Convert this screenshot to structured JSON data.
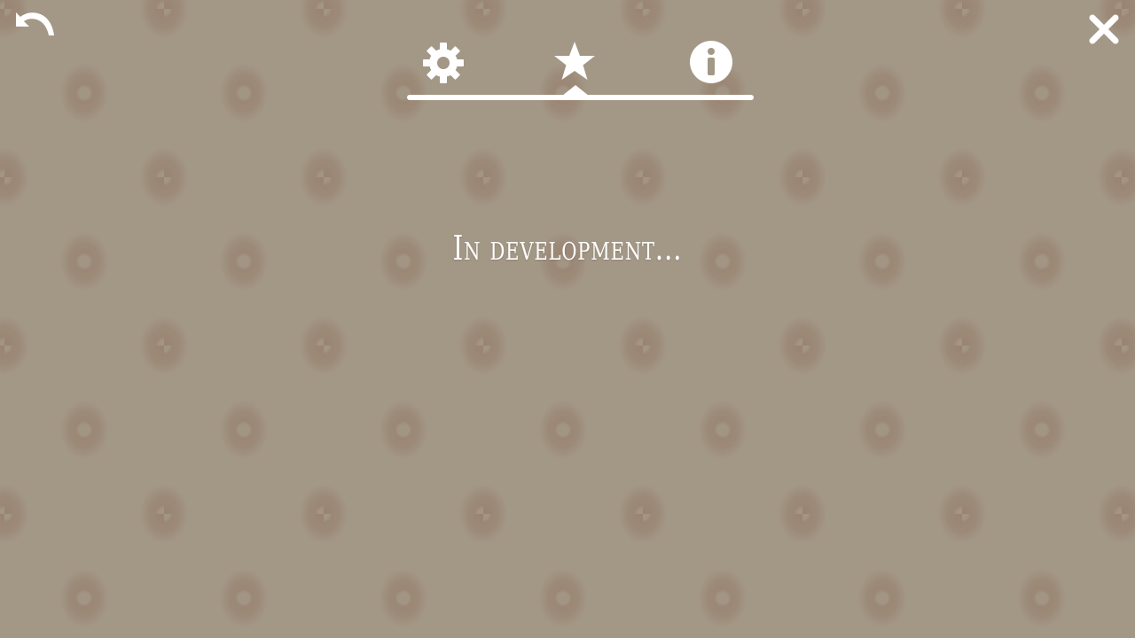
{
  "toolbar": {
    "back_icon": "undo-arrow-icon",
    "close_icon": "close-x-icon"
  },
  "tabs": [
    {
      "id": "settings",
      "icon": "gear-icon",
      "active": false
    },
    {
      "id": "favorites",
      "icon": "star-icon",
      "active": true
    },
    {
      "id": "info",
      "icon": "info-icon",
      "active": false
    }
  ],
  "content": {
    "message": "In development..."
  },
  "colors": {
    "background": "#a39786",
    "pattern": "#91735f",
    "foreground": "#ffffff"
  }
}
